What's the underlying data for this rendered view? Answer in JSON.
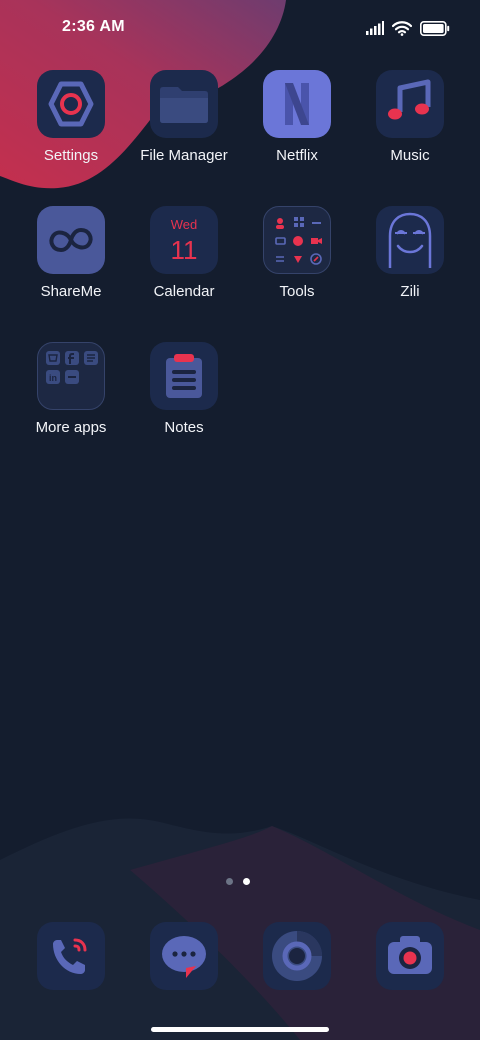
{
  "status_bar": {
    "time": "2:36 AM",
    "icons": [
      "signal-icon",
      "wifi-icon",
      "battery-icon"
    ]
  },
  "apps": [
    {
      "label": "Settings",
      "icon": "settings-icon"
    },
    {
      "label": "File Manager",
      "icon": "folder-icon"
    },
    {
      "label": "Netflix",
      "icon": "netflix-icon"
    },
    {
      "label": "Music",
      "icon": "music-note-icon"
    },
    {
      "label": "ShareMe",
      "icon": "infinity-icon"
    },
    {
      "label": "Calendar",
      "icon": "calendar-icon",
      "day": "Wed",
      "date": "11"
    },
    {
      "label": "Tools",
      "icon": "tools-folder-icon"
    },
    {
      "label": "Zili",
      "icon": "zili-face-icon"
    },
    {
      "label": "More apps",
      "icon": "apps-folder-icon"
    },
    {
      "label": "Notes",
      "icon": "notes-icon"
    }
  ],
  "page_indicator": {
    "pages": 2,
    "current": 2
  },
  "dock": [
    {
      "icon": "phone-icon"
    },
    {
      "icon": "messages-icon"
    },
    {
      "icon": "browser-icon"
    },
    {
      "icon": "camera-icon"
    }
  ],
  "colors": {
    "background": "#141d2e",
    "icon_tile": "#1c2a4c",
    "accent_red": "#e8334f",
    "accent_purple": "#5a68b8",
    "wallpaper_blob": "#c7334f"
  }
}
